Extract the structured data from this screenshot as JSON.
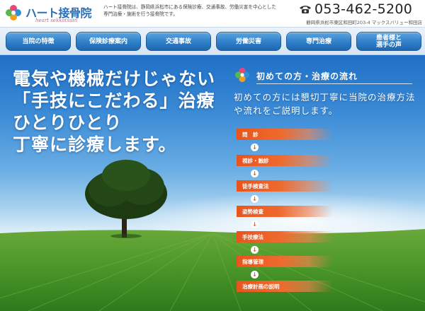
{
  "header": {
    "logo_text": "ハート接骨院",
    "logo_sub": "heart sekkotsuin",
    "intro": "ハート接骨院は、静岡県浜松市にある保険診療、交通事故、労働災害を中心とした専門治療・施術を行う接骨院です。",
    "phone": "053-462-5200",
    "address": "静岡県浜松市東区和田町203-4 マックスバリュー和田店"
  },
  "nav": {
    "items": [
      {
        "label": "当院の特徴"
      },
      {
        "label": "保険診療案内"
      },
      {
        "label": "交通事故"
      },
      {
        "label": "労働災害"
      },
      {
        "label": "専門治療"
      },
      {
        "label": "患者様と\n選手の声"
      }
    ]
  },
  "hero": {
    "headline": [
      "電気や機械だけじゃない",
      "「手技にこだわる」治療",
      "ひとりひとり",
      "丁寧に診療します。"
    ]
  },
  "flow": {
    "title": "初めての方・治療の流れ",
    "desc": "初めての方には懇切丁寧に当院の治療方法や流れをご説明します。",
    "steps": [
      {
        "label": "問　診"
      },
      {
        "label": "視診・触診"
      },
      {
        "label": "徒手検査法"
      },
      {
        "label": "姿勢検査"
      },
      {
        "label": "手技療法"
      },
      {
        "label": "指導管理"
      },
      {
        "label": "治療計画の説明"
      }
    ]
  },
  "colors": {
    "brand_blue": "#2f7fc8",
    "step_orange": "#e8541c"
  },
  "icons": {
    "phone": "phone-icon",
    "logo_mark": "four-leaf-icon",
    "step_arrow": "arrow-down-icon"
  }
}
